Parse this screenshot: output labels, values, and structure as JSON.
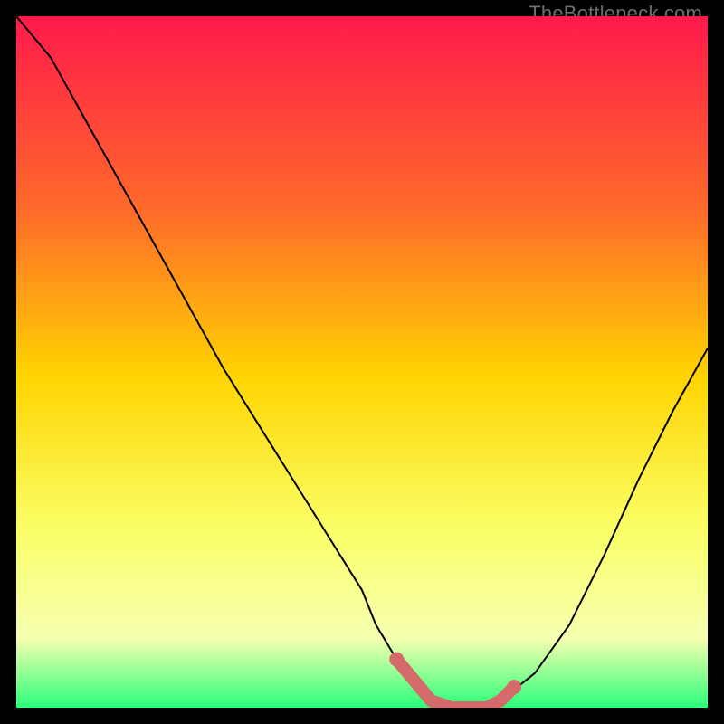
{
  "watermark": "TheBottleneck.com",
  "colors": {
    "gradient_top": "#ff1a4b",
    "gradient_mid_upper": "#ff6a2a",
    "gradient_mid": "#ffd400",
    "gradient_mid_lower": "#faff66",
    "gradient_low": "#f6ffb0",
    "gradient_bottom": "#2bff7a",
    "line": "#000000",
    "marker": "#d46a6a",
    "background": "#000000"
  },
  "chart_data": {
    "type": "line",
    "title": "",
    "xlabel": "",
    "ylabel": "",
    "xlim": [
      0,
      100
    ],
    "ylim": [
      0,
      100
    ],
    "series": [
      {
        "name": "bottleneck-curve",
        "x": [
          0,
          5,
          10,
          15,
          20,
          25,
          30,
          35,
          40,
          45,
          50,
          52,
          55,
          58,
          60,
          63,
          66,
          68,
          70,
          75,
          80,
          85,
          90,
          95,
          100
        ],
        "values": [
          100,
          94,
          85,
          76,
          67,
          58,
          49,
          41,
          33,
          25,
          17,
          12,
          7,
          3,
          1,
          0,
          0,
          0,
          1,
          5,
          12,
          22,
          33,
          43,
          52
        ]
      }
    ],
    "markers": {
      "name": "highlighted-range",
      "x": [
        55,
        60,
        63,
        66,
        68,
        70,
        72
      ],
      "values": [
        7,
        1,
        0,
        0,
        0,
        1,
        3
      ]
    }
  }
}
